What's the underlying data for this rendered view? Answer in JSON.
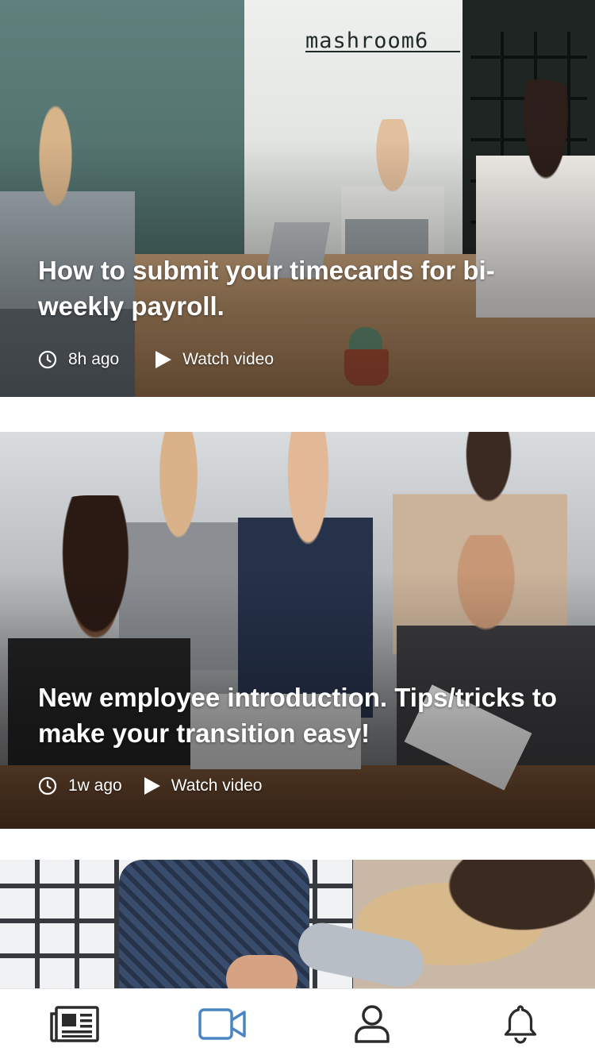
{
  "feed": {
    "cards": [
      {
        "title": "How to submit your timecards for bi-weekly payroll.",
        "time_ago": "8h ago",
        "watch_label": "Watch video",
        "brand_text": "mashroom6"
      },
      {
        "title": "New employee introduction. Tips/tricks to make your transition easy!",
        "time_ago": "1w ago",
        "watch_label": "Watch video"
      },
      {
        "title": "",
        "time_ago": "",
        "watch_label": ""
      }
    ]
  },
  "tabbar": {
    "tabs": [
      {
        "icon": "newspaper-icon",
        "active": false
      },
      {
        "icon": "video-camera-icon",
        "active": true
      },
      {
        "icon": "user-icon",
        "active": false
      },
      {
        "icon": "bell-icon",
        "active": false
      }
    ],
    "active_color": "#4a86c5",
    "inactive_color": "#2b2b2b"
  }
}
